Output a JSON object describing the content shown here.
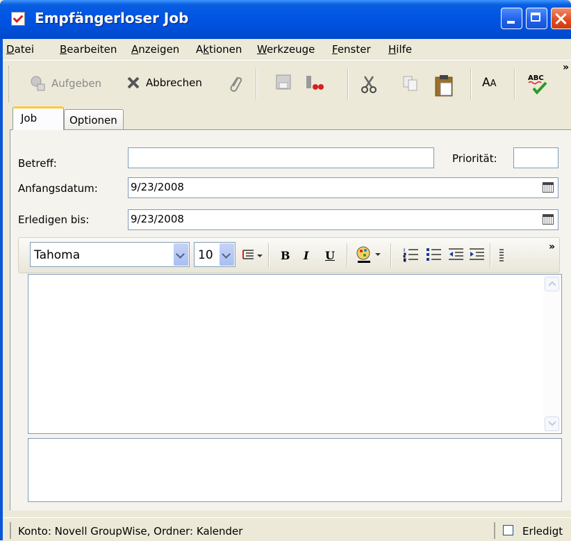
{
  "window": {
    "title": "Empfängerloser Job",
    "app_icon": "checkmark-task-icon",
    "controls": [
      "minimize-icon",
      "maximize-icon",
      "close-icon"
    ]
  },
  "menubar": {
    "items": [
      {
        "label": "Datei",
        "mnemonic": "D"
      },
      {
        "label": "Bearbeiten",
        "mnemonic": "B"
      },
      {
        "label": "Anzeigen",
        "mnemonic": "A"
      },
      {
        "label": "Aktionen",
        "mnemonic": "k"
      },
      {
        "label": "Werkzeuge",
        "mnemonic": "W"
      },
      {
        "label": "Fenster",
        "mnemonic": "F"
      },
      {
        "label": "Hilfe",
        "mnemonic": "H"
      }
    ]
  },
  "toolbar": {
    "post_label": "Aufgeben",
    "cancel_label": "Abbrechen",
    "icons": [
      "post-icon",
      "cancel-icon",
      "attach-paperclip-icon",
      "save-icon",
      "address-book-icon",
      "cut-icon",
      "copy-icon",
      "paste-icon",
      "font-icon",
      "spellcheck-icon"
    ],
    "overflow": "»"
  },
  "tabs": [
    {
      "label": "Job",
      "active": true
    },
    {
      "label": "Optionen",
      "active": false
    }
  ],
  "form": {
    "subject_label": "Betreff:",
    "subject_value": "",
    "priority_label": "Priorität:",
    "priority_value": "",
    "start_label": "Anfangsdatum:",
    "start_value": "9/23/2008",
    "due_label": "Erledigen bis:",
    "due_value": "9/23/2008"
  },
  "format": {
    "font": "Tahoma",
    "size": "10",
    "bold": "B",
    "italic": "I",
    "underline": "U",
    "overflow": "»"
  },
  "statusbar": {
    "text": "Konto: Novell GroupWise,  Ordner: Kalender",
    "done_label": "Erledigt",
    "done_checked": false
  },
  "colors": {
    "titlebar": "#0055E5",
    "close": "#E04A1E",
    "tab_highlight": "#FFC83C",
    "field_border": "#7F9DB9"
  }
}
